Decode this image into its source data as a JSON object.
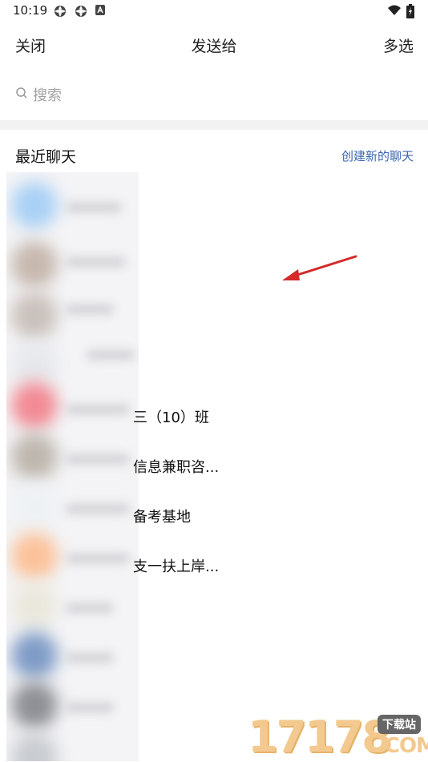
{
  "status_bar": {
    "time": "10:19"
  },
  "header": {
    "left_label": "关闭",
    "title": "发送给",
    "right_label": "多选"
  },
  "search": {
    "placeholder": "搜索"
  },
  "section": {
    "title": "最近聊天",
    "link": "创建新的聊天"
  },
  "rows": [
    {
      "name": "三（10）班"
    },
    {
      "name": "信息兼职咨..."
    },
    {
      "name": "备考基地"
    },
    {
      "name": "支一扶上岸..."
    }
  ],
  "watermark": {
    "number": "17178",
    "badge": "下载站",
    "domain": ".COM"
  },
  "colors": {
    "link": "#3a66b0",
    "divider": "#f2f2f2",
    "arrow": "#d32a2a",
    "watermark": "#f3c98f"
  }
}
